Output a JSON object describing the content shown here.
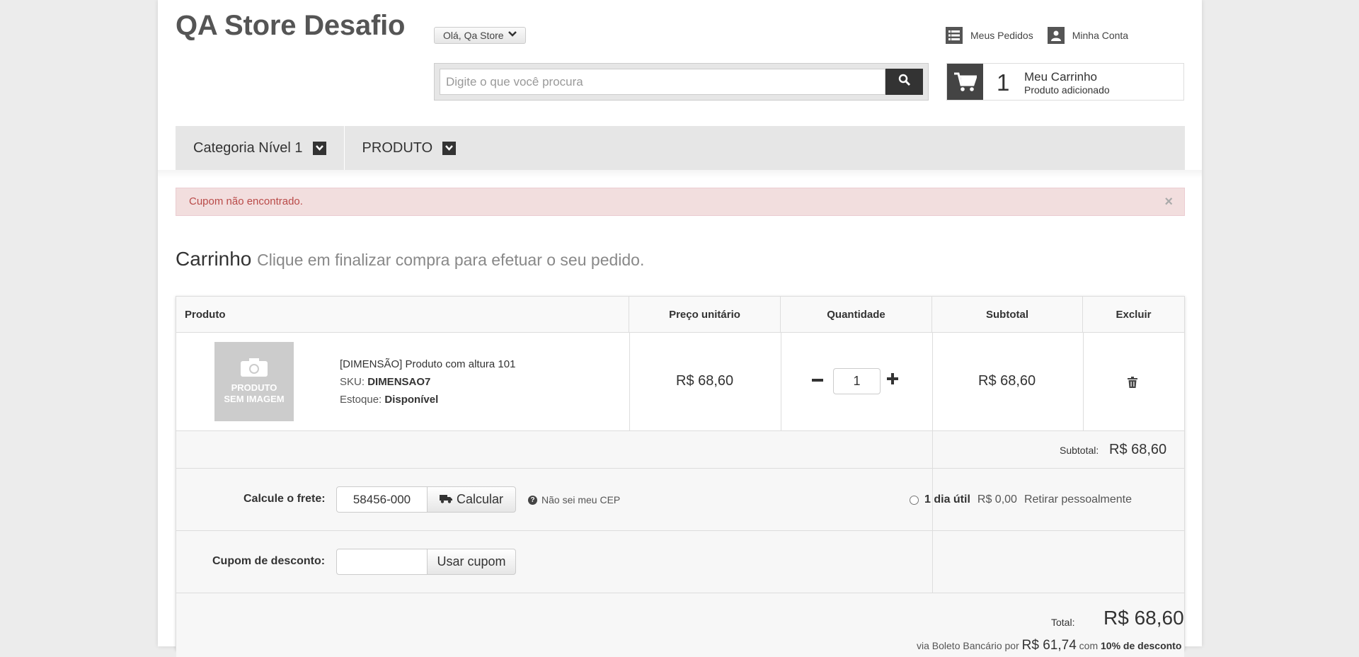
{
  "header": {
    "logo": "QA Store Desafio",
    "greeting": "Olá, Qa Store",
    "links": {
      "orders": "Meus Pedidos",
      "account": "Minha Conta"
    },
    "search": {
      "placeholder": "Digite o que você procura"
    },
    "cart": {
      "count": "1",
      "title": "Meu Carrinho",
      "subtitle": "Produto adicionado"
    }
  },
  "nav": {
    "items": [
      {
        "label": "Categoria Nível 1"
      },
      {
        "label": "PRODUTO"
      }
    ]
  },
  "alert": {
    "message": "Cupom não encontrado.",
    "close": "×"
  },
  "page": {
    "title": "Carrinho",
    "subtitle": "Clique em finalizar compra para efetuar o seu pedido."
  },
  "table": {
    "headers": {
      "product": "Produto",
      "unit_price": "Preço unitário",
      "quantity": "Quantidade",
      "subtotal": "Subtotal",
      "remove": "Excluir"
    },
    "item": {
      "thumb_line1": "PRODUTO",
      "thumb_line2": "SEM IMAGEM",
      "name": "[DIMENSÃO] Produto com altura 101",
      "sku_label": "SKU:",
      "sku": "DIMENSAO7",
      "stock_label": "Estoque:",
      "stock": "Disponível",
      "unit_price": "R$ 68,60",
      "quantity": "1",
      "subtotal": "R$ 68,60"
    }
  },
  "summary": {
    "subtotal_label": "Subtotal:",
    "subtotal_value": "R$ 68,60",
    "shipping": {
      "label": "Calcule o frete:",
      "cep": "58456-000",
      "button": "Calcular",
      "help": "Não sei meu CEP",
      "option_days": "1 dia útil",
      "option_price": "R$ 0,00",
      "option_name": "Retirar pessoalmente"
    },
    "coupon": {
      "label": "Cupom de desconto:",
      "value": "",
      "button": "Usar cupom"
    },
    "total_label": "Total:",
    "total_value": "R$ 68,60",
    "boleto_prefix": "via Boleto Bancário por",
    "boleto_value": "R$ 61,74",
    "boleto_com": "com",
    "boleto_discount": "10% de desconto"
  }
}
